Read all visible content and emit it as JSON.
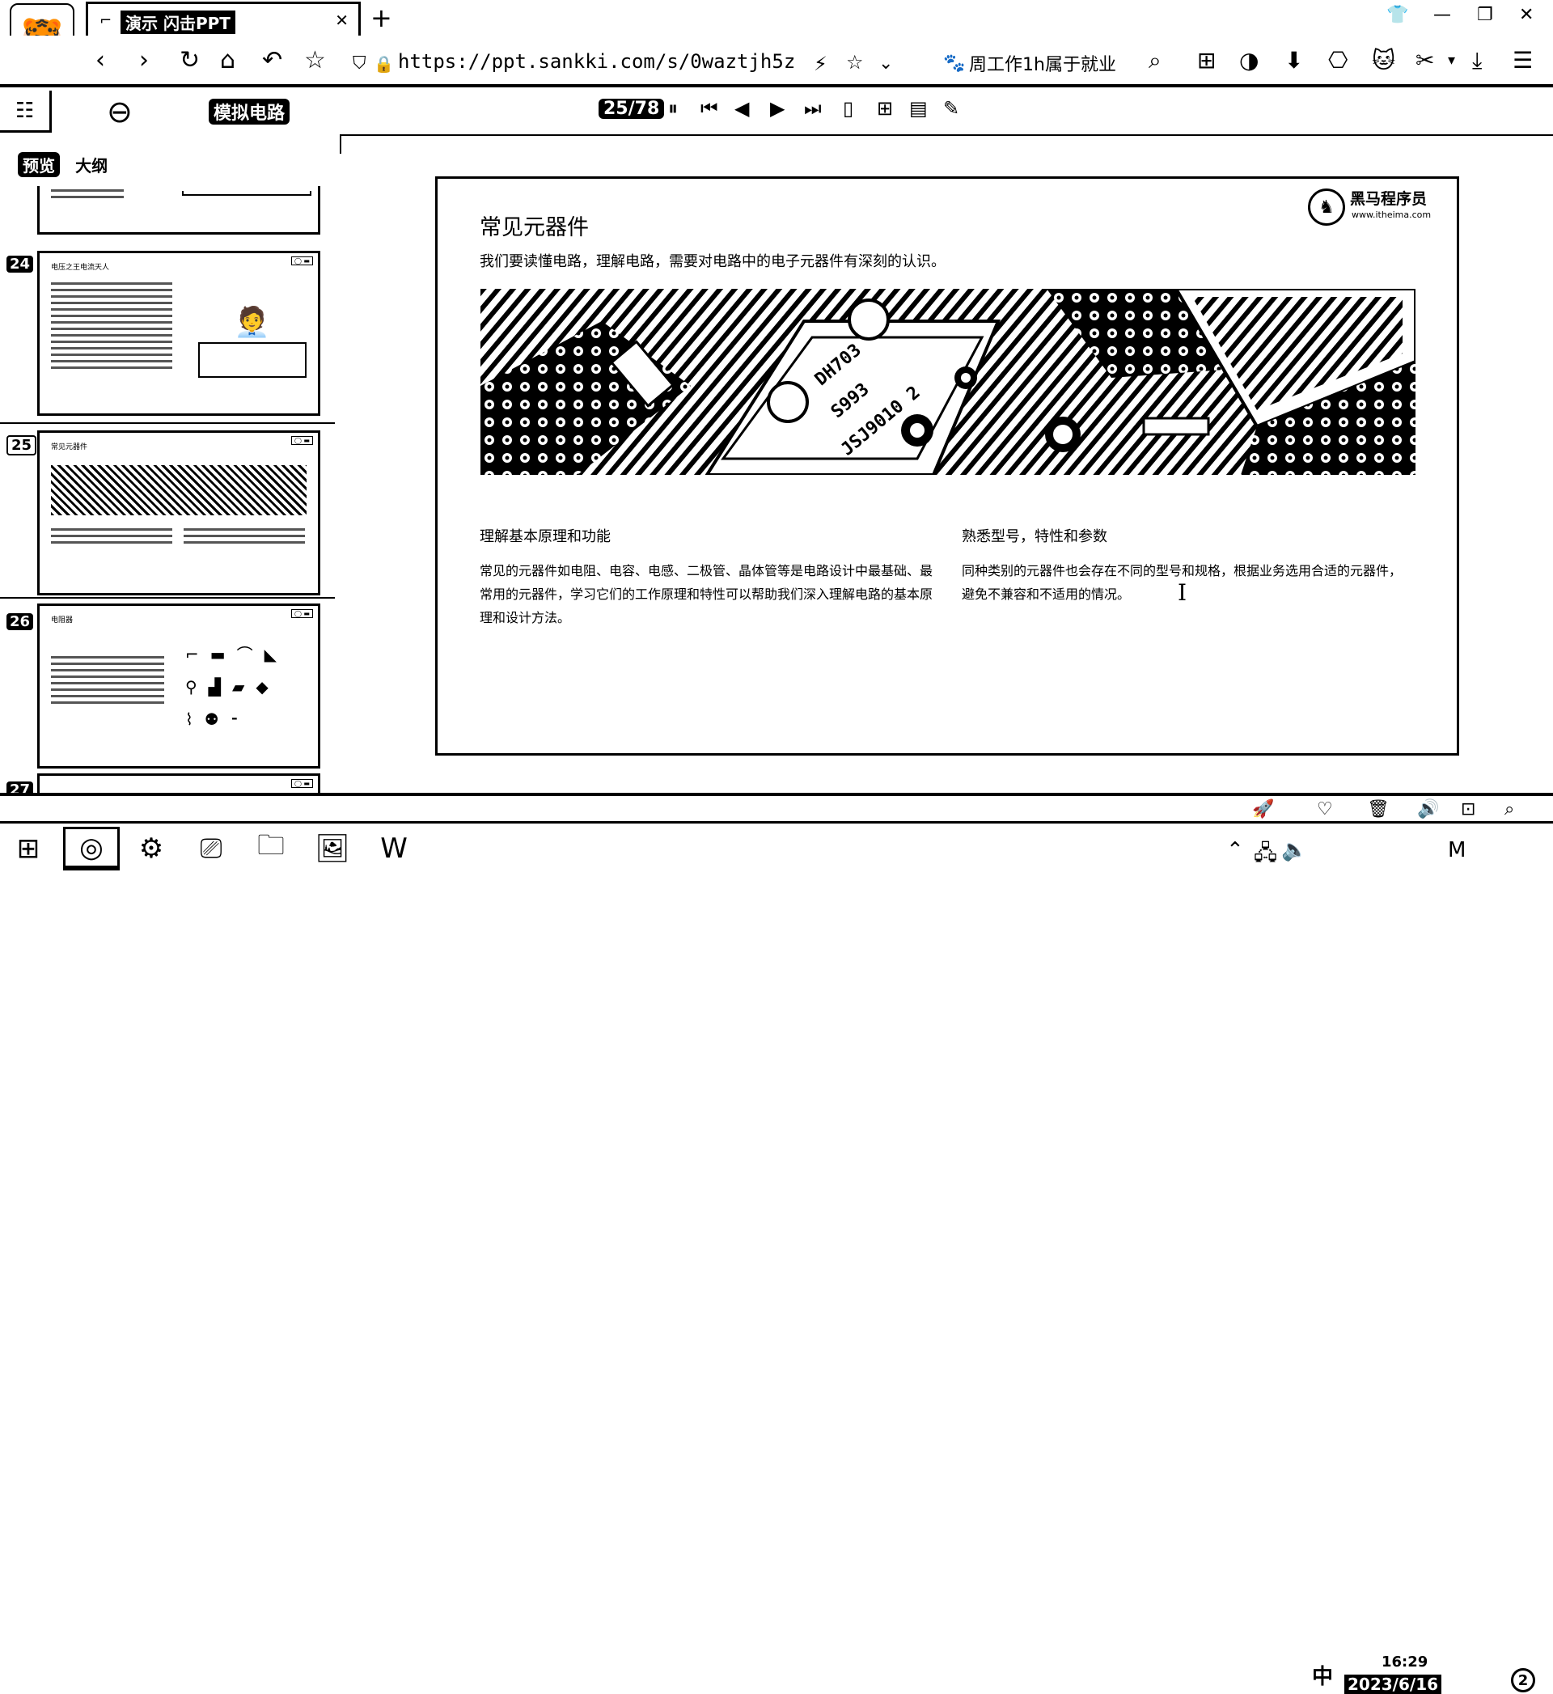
{
  "browser": {
    "tab_title": "演示 闪击PPT",
    "new_tab": "+",
    "url": "https://ppt.sankki.com/s/0waztjh5z",
    "bookmark_text": "周工作1h属于就业",
    "icons": {
      "logo": "tiger-logo-icon",
      "back": "back-icon",
      "forward": "forward-icon",
      "reload": "reload-icon",
      "home": "home-icon",
      "undo": "undo-close-tab-icon",
      "star": "star-icon",
      "shield": "shield-icon",
      "lock": "lock-icon"
    }
  },
  "app": {
    "doc_title": "模拟电路",
    "page_counter": "25/78",
    "sidebar_tabs": [
      "预览",
      "大纲"
    ]
  },
  "thumbnails": [
    {
      "num": "24",
      "title": "电压之王电流天人"
    },
    {
      "num": "25",
      "title": "常见元器件"
    },
    {
      "num": "26",
      "title": "电阻器"
    },
    {
      "num": "27",
      "title": ""
    }
  ],
  "slide": {
    "title": "常见元器件",
    "intro": "我们要读懂电路，理解电路，需要对电路中的电子元器件有深刻的认识。",
    "brand_name": "黑马程序员",
    "brand_url": "www.itheima.com",
    "col1_title": "理解基本原理和功能",
    "col1_body": "常见的元器件如电阻、电容、电感、二极管、晶体管等是电路设计中最基础、最常用的元器件，学习它们的工作原理和特性可以帮助我们深入理解电路的基本原理和设计方法。",
    "col2_title": "熟悉型号，特性和参数",
    "col2_body": "同种类别的元器件也会存在不同的型号和规格，根据业务选用合适的元器件，避免不兼容和不适用的情况。",
    "chip_labels": [
      "DH703",
      "S993",
      "JSJ9010 2"
    ]
  },
  "taskbar": {
    "ime": "中",
    "time": "16:29",
    "date": "2023/6/16",
    "notifications": "2"
  }
}
